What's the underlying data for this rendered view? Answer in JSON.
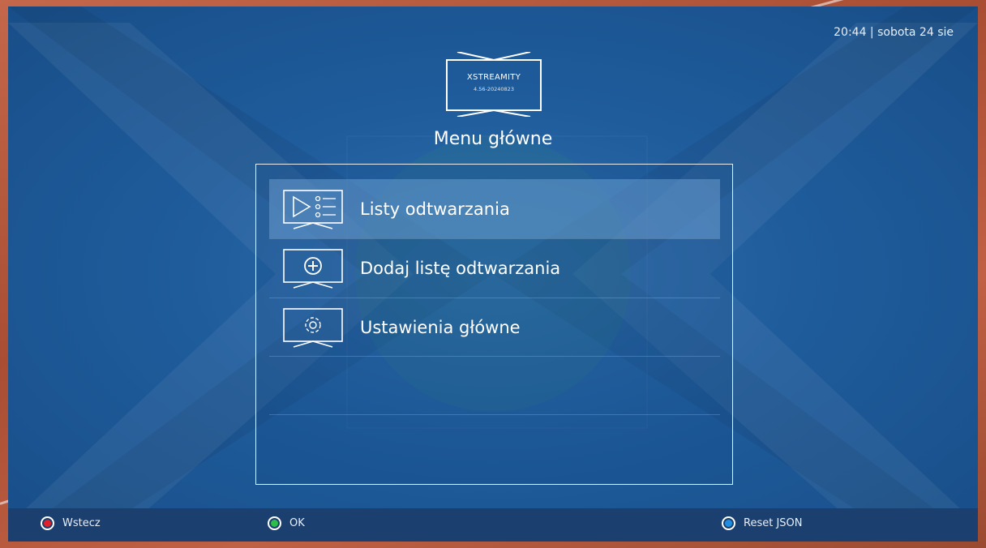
{
  "status": {
    "clock": "20:44 | sobota 24 sie"
  },
  "logo": {
    "name": "XSTREAMITY",
    "version": "4.56-20240823"
  },
  "page": {
    "title": "Menu główne"
  },
  "menu": {
    "items": [
      {
        "label": "Listy odtwarzania",
        "icon": "playlist-icon",
        "selected": true
      },
      {
        "label": "Dodaj listę odtwarzania",
        "icon": "add-circle-icon",
        "selected": false
      },
      {
        "label": "Ustawienia główne",
        "icon": "gear-icon",
        "selected": false
      }
    ]
  },
  "footer": {
    "red": {
      "label": "Wstecz",
      "color": "#e0202a"
    },
    "green": {
      "label": "OK",
      "color": "#2bbf4a"
    },
    "blue": {
      "label": "Reset JSON",
      "color": "#1e8fe0"
    }
  }
}
